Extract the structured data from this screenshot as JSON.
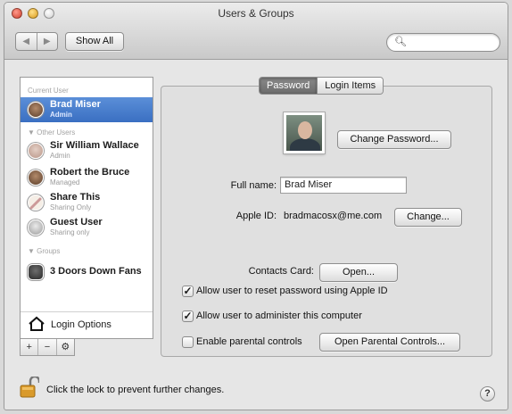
{
  "window": {
    "title": "Users & Groups"
  },
  "toolbar": {
    "back_icon": "chevron-left",
    "forward_icon": "chevron-right",
    "show_all_label": "Show All",
    "search": {
      "value": "",
      "placeholder": "",
      "icon": "search-icon"
    }
  },
  "sidebar": {
    "current_user_header": "Current User",
    "current_user": {
      "name": "Brad Miser",
      "role": "Admin",
      "selected": true
    },
    "other_users_header": "Other Users",
    "other_users": [
      {
        "name": "Sir William Wallace",
        "role": "Admin"
      },
      {
        "name": "Robert the Bruce",
        "role": "Managed"
      },
      {
        "name": "Share This",
        "role": "Sharing Only"
      },
      {
        "name": "Guest User",
        "role": "Sharing only"
      }
    ],
    "groups_header": "Groups",
    "groups": [
      {
        "name": "3 Doors Down Fans"
      }
    ],
    "login_options_label": "Login Options",
    "tools": {
      "add": "+",
      "remove": "−",
      "action_icon": "gear-icon"
    }
  },
  "tabs": [
    {
      "label": "Password",
      "active": true
    },
    {
      "label": "Login Items",
      "active": false
    }
  ],
  "password_tab": {
    "change_password_label": "Change Password...",
    "full_name_label": "Full name:",
    "full_name_value": "Brad Miser",
    "apple_id_label": "Apple ID:",
    "apple_id_value": "bradmacosx@me.com",
    "change_label": "Change...",
    "contacts_card_label": "Contacts Card:",
    "open_label": "Open...",
    "checkboxes": [
      {
        "label": "Allow user to reset password using Apple ID",
        "checked": true
      },
      {
        "label": "Allow user to administer this computer",
        "checked": true
      },
      {
        "label": "Enable parental controls",
        "checked": false
      }
    ],
    "open_parental_controls_label": "Open Parental Controls..."
  },
  "footer": {
    "lock_text": "Click the lock to prevent further changes.",
    "help_label": "?"
  },
  "colors": {
    "selection": "#3a6fc2",
    "window_bg": "#e6e6e6"
  }
}
